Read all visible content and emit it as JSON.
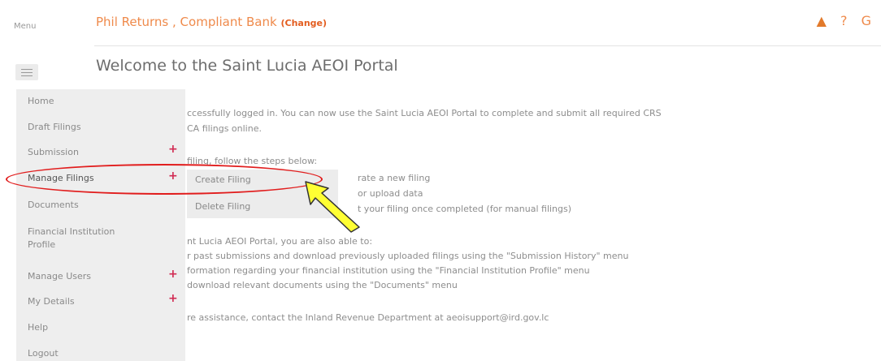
{
  "header": {
    "org_title": "Phil Returns , Compliant Bank",
    "change_label": "(Change)",
    "icons": [
      "user-icon",
      "help-icon",
      "logout-icon"
    ],
    "help_glyph": "?",
    "logout_glyph": "G"
  },
  "menu": {
    "label": "Menu"
  },
  "page": {
    "title": "Welcome to the Saint Lucia AEOI Portal"
  },
  "sidebar": {
    "items": [
      {
        "label": "Home"
      },
      {
        "label": "Draft Filings"
      },
      {
        "label": "Submission"
      },
      {
        "label": "Manage Filings"
      },
      {
        "label": "Documents"
      },
      {
        "label": "Financial Institution"
      },
      {
        "label": "Profile"
      },
      {
        "label": "Manage Users"
      },
      {
        "label": "My Details"
      },
      {
        "label": "Help"
      },
      {
        "label": "Logout"
      }
    ],
    "plus_glyph": "+"
  },
  "submenu": {
    "items": [
      {
        "label": "Create Filing"
      },
      {
        "label": "Delete Filing"
      }
    ]
  },
  "content": {
    "lines": [
      "ccessfully logged in. You can now use the Saint Lucia AEOI Portal to complete and submit all required CRS",
      "CA filings online.",
      "filing, follow the steps below:",
      "rate a new filing",
      "or upload data",
      "t your filing once completed (for manual filings)",
      "nt Lucia AEOI Portal, you are also able to:",
      "r past submissions and download previously uploaded filings using the \"Submission History\" menu",
      "formation regarding your financial institution using the \"Financial Institution Profile\" menu",
      "download relevant documents using the \"Documents\" menu",
      "re assistance, contact the Inland Revenue Department at aeoisupport@ird.gov.lc"
    ]
  },
  "colors": {
    "accent": "#ef8a4b",
    "plus": "#d12a52",
    "highlight": "#e11d1d",
    "arrow": "#ffff33"
  }
}
